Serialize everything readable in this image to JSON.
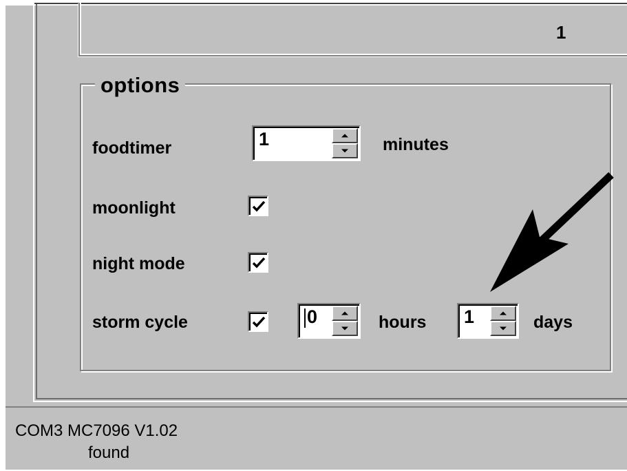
{
  "top_group": {
    "value": "1"
  },
  "options": {
    "title": "options",
    "foodtimer": {
      "label": "foodtimer",
      "value": "1",
      "unit": "minutes"
    },
    "moonlight": {
      "label": "moonlight",
      "checked": true
    },
    "night_mode": {
      "label": "night mode",
      "checked": true
    },
    "storm_cycle": {
      "label": "storm cycle",
      "checked": true,
      "hours_value": "0",
      "hours_unit": "hours",
      "days_value": "1",
      "days_unit": "days"
    }
  },
  "status": {
    "line1": "COM3 MC7096 V1.02",
    "line2": "found"
  },
  "icons": {
    "check": "check-mark-icon",
    "spin_up": "spin-up-icon",
    "spin_down": "spin-down-icon",
    "annotation": "annotation-arrow-icon"
  },
  "colors": {
    "face": "#c0c0c0",
    "shadow": "#808080",
    "highlight": "#ffffff",
    "text": "#000000"
  }
}
